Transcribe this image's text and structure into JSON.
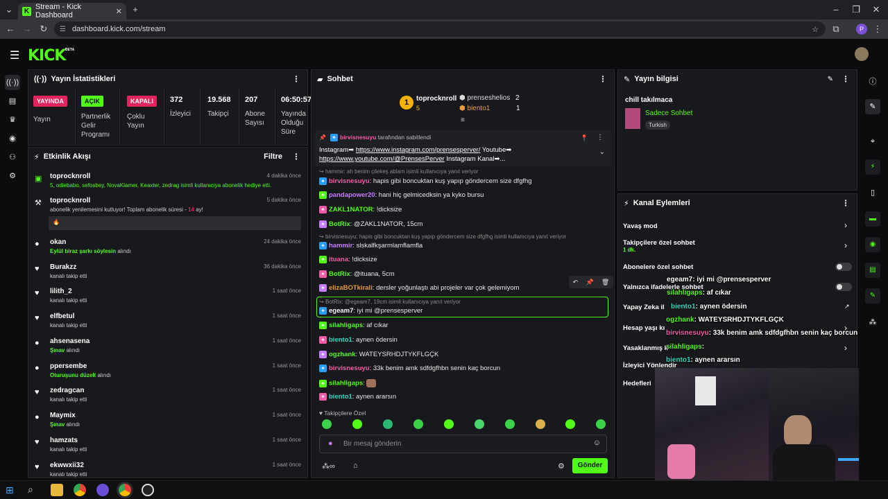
{
  "browser": {
    "tab_title": "Stream - Kick Dashboard",
    "url": "dashboard.kick.com/stream",
    "profile_initial": "P"
  },
  "brand": {
    "logo": "KICK",
    "beta": "BETA",
    "accent": "#53fc18"
  },
  "stats": {
    "title": "Yayın İstatistikleri",
    "items": [
      {
        "badge": "YAYINDA",
        "label": "Yayın"
      },
      {
        "badge": "AÇIK",
        "label": "Partnerlik Gelir Programı"
      },
      {
        "badge": "KAPALI",
        "label": "Çoklu Yayın"
      },
      {
        "value": "372",
        "label": "İzleyici"
      },
      {
        "value": "19.568",
        "label": "Takipçi"
      },
      {
        "value": "207",
        "label": "Abone Sayısı"
      },
      {
        "value": "06:50:57",
        "label": "Yayında Olduğu Süre"
      }
    ]
  },
  "activity": {
    "title": "Etkinlik Akışı",
    "filter": "Filtre",
    "items": [
      {
        "name": "toprocknroll",
        "time": "4 dakika önce",
        "sub": "5, odiebabo, sefosbey, NovaKlamer, Keaxter, zedrag isimli kullanıcıya abonelik hediye etti."
      },
      {
        "name": "toprocknroll",
        "time": "5 dakika önce",
        "sub_a": "abonelik yenilemesini kutluyor! Toplam abonelik süresi - ",
        "sub_b": "14",
        "sub_c": " ay!",
        "msg": "🔥"
      },
      {
        "name": "okan",
        "time": "24 dakika önce",
        "hl": "Eylül biraz şarkı söylesin",
        "sub": " alındı"
      },
      {
        "name": "Burakzz",
        "time": "36 dakika önce",
        "sub": "kanalı takip etti"
      },
      {
        "name": "lilith_2",
        "time": "1 saat önce",
        "sub": "kanalı takip etti"
      },
      {
        "name": "elfbetul",
        "time": "1 saat önce",
        "sub": "kanalı takip etti"
      },
      {
        "name": "ahsenasena",
        "time": "1 saat önce",
        "hl": "Şınav",
        "sub": " alındı"
      },
      {
        "name": "ppersembe",
        "time": "1 saat önce",
        "hl": "Oturuşunu düzelt",
        "sub": " alındı"
      },
      {
        "name": "zedragcan",
        "time": "1 saat önce",
        "sub": "kanalı takip etti"
      },
      {
        "name": "Maymix",
        "time": "1 saat önce",
        "hl": "Şınav",
        "sub": " alındı"
      },
      {
        "name": "hamzats",
        "time": "1 saat önce",
        "sub": "kanalı takip etti"
      },
      {
        "name": "ekwwxii32",
        "time": "1 saat önce",
        "sub": "kanalı takip etti"
      }
    ]
  },
  "chat": {
    "title": "Sohbet",
    "leaders": {
      "first": {
        "rank": "1",
        "name": "toprocknroll",
        "count": "5"
      },
      "second": {
        "name": "prenseshelios",
        "count": "2"
      },
      "third": {
        "name": "biento1",
        "count": "1"
      }
    },
    "pinned": {
      "by_user": "birvisnesuyu",
      "by_text": " tarafından sabitlendi",
      "line1_a": "Instagram➡ ",
      "line1_link": "https://www.instagram.com/prensesperver/",
      "line1_b": " Youtube➡",
      "line2_link": "https://www.youtube.com/@PrensesPerver",
      "line2_b": " Instagram Kanal➡..."
    },
    "reply_top": "hammir: ah benim çilekeş ablam isimli kullanıcıya yanıt veriyor",
    "messages": [
      {
        "user": "birvisnesuyu",
        "color": "#f25ba8",
        "text": ": hapis gibi boncuktan kuş yapıp göndercem size dfgfhg"
      },
      {
        "user": "pandapower20",
        "color": "#c77dff",
        "text": ": hani hiç gelmicedksin ya kyko bursu"
      },
      {
        "user": "ZAKL1NATOR",
        "color": "#53fc18",
        "text": ": !dicksize"
      },
      {
        "user": "BotRix",
        "color": "#53fc18",
        "text": ": @ZAKL1NATOR, 15cm"
      },
      {
        "reply": "birvisnesuyu: hapis gibi boncuktan kuş yapıp göndercem size dfgfhg isimli kullanıcıya yanıt veriyor",
        "user": "hammir",
        "color": "#c77dff",
        "text": ": slskalfkşarmlamflamfla"
      },
      {
        "user": "ituana",
        "color": "#f25ba8",
        "text": ": !dicksize"
      },
      {
        "user": "BotRix",
        "color": "#53fc18",
        "text": ": @ituana, 5cm"
      },
      {
        "user": "elizaBOTkirali",
        "color": "#e89b3c",
        "text": ": dersler yoğunlaştı abi projeler var çok gelemiyom"
      },
      {
        "reply": "BotRix: @egeam7, 19cm isimli kullanıcıya yanıt veriyor",
        "user": "egeam7",
        "color": "#ffffff",
        "text": ": iyi mi @prensesperver"
      },
      {
        "user": "silahligaps",
        "color": "#53fc18",
        "text": ": af cıkar"
      },
      {
        "user": "biento1",
        "color": "#35d6c4",
        "text": ": aynen ödersin"
      },
      {
        "user": "ogzhank",
        "color": "#53fc18",
        "text": ": WATEYSRHDJTYKFLGÇK"
      },
      {
        "user": "birvisnesuyu",
        "color": "#f25ba8",
        "text": ": 33k benim amk sdfdgfhbn senin kaç borcun"
      },
      {
        "user": "silahligaps",
        "color": "#53fc18",
        "text": ": "
      },
      {
        "user": "biento1",
        "color": "#35d6c4",
        "text": ": aynen ararsın"
      }
    ],
    "followers_only": "Takipçilere Özel",
    "input_placeholder": "Bir mesaj gönderin",
    "send": "Gönder"
  },
  "info": {
    "title": "Yayın bilgisi",
    "stream_title": "chill takılmaca",
    "category": "Sadece Sohbet",
    "tag": "Turkish"
  },
  "actions": {
    "title": "Kanal Eylemleri",
    "items": [
      {
        "label": "Yavaş mod"
      },
      {
        "label": "Takipçilere özel sohbet",
        "sub": "1 dk."
      },
      {
        "label": "Abonelere özel sohbet"
      },
      {
        "label": "Yalnızca ifadelerle sohbet"
      },
      {
        "label": "Yapay Zeka il"
      },
      {
        "label": "Hesap yaşı kı"
      },
      {
        "label": "Yasaklanmış k"
      },
      {
        "label": "İzleyici Yönlendir"
      },
      {
        "label": "Hedefleri"
      }
    ]
  },
  "overlay": [
    {
      "user": "egeam7",
      "text": ": iyi mi @prensesperver"
    },
    {
      "user": "silahligaps",
      "text": ": af cıkar"
    },
    {
      "user": "biento1",
      "text": ": aynen ödersin"
    },
    {
      "user": "ogzhank",
      "text": ": WATEYSRHDJTYKFLGÇK"
    },
    {
      "user": "birvisnesuyu",
      "text": ": 33k benim amk sdfdgfhbn senin kaç borcun"
    },
    {
      "user": "silahligaps",
      "text": ": "
    },
    {
      "user": "biento1",
      "text": ": aynen ararsın"
    }
  ]
}
